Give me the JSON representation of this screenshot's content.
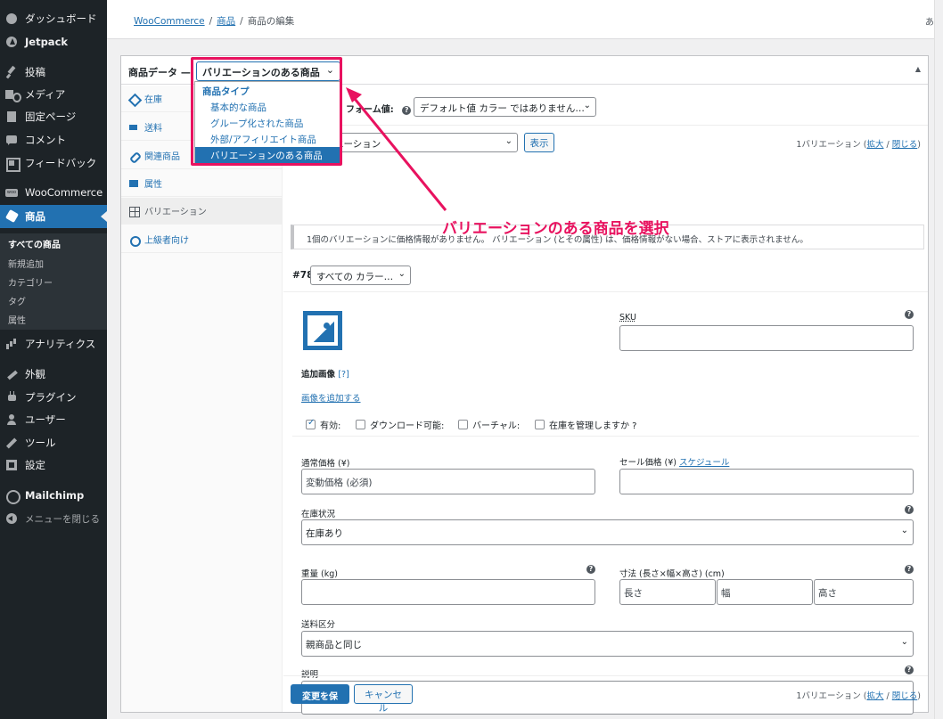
{
  "sidebar": {
    "items": [
      {
        "label": "ダッシュボード",
        "icon": "dashboard-icon"
      },
      {
        "label": "Jetpack",
        "icon": "jetpack-icon"
      },
      {
        "label": "投稿",
        "icon": "pin-icon"
      },
      {
        "label": "メディア",
        "icon": "media-icon"
      },
      {
        "label": "固定ページ",
        "icon": "page-icon"
      },
      {
        "label": "コメント",
        "icon": "comment-icon"
      },
      {
        "label": "フィードバック",
        "icon": "feedback-icon"
      },
      {
        "label": "WooCommerce",
        "icon": "woocommerce-icon"
      },
      {
        "label": "商品",
        "icon": "product-box-icon"
      },
      {
        "label": "アナリティクス",
        "icon": "analytics-icon"
      },
      {
        "label": "外観",
        "icon": "brush-icon"
      },
      {
        "label": "プラグイン",
        "icon": "plugin-icon"
      },
      {
        "label": "ユーザー",
        "icon": "user-icon"
      },
      {
        "label": "ツール",
        "icon": "wrench-icon"
      },
      {
        "label": "設定",
        "icon": "settings-icon"
      },
      {
        "label": "Mailchimp",
        "icon": "mailchimp-icon"
      },
      {
        "label": "メニューを閉じる",
        "icon": "collapse-icon"
      }
    ],
    "submenu": [
      "すべての商品",
      "新規追加",
      "カテゴリー",
      "タグ",
      "属性"
    ]
  },
  "breadcrumb": {
    "woocommerce": "WooCommerce",
    "products": "商品",
    "current": "商品の編集",
    "tail": "あ"
  },
  "panel": {
    "title": "商品データ —",
    "type_selected": "バリエーションのある商品",
    "chevron": "⌄",
    "collapse_arrow": "▲",
    "tabs": [
      {
        "label": "在庫",
        "icon": "inventory-icon"
      },
      {
        "label": "送料",
        "icon": "shipping-icon"
      },
      {
        "label": "関連商品",
        "icon": "link-icon"
      },
      {
        "label": "属性",
        "icon": "attributes-icon"
      },
      {
        "label": "バリエーション",
        "icon": "grid-icon"
      },
      {
        "label": "上級者向け",
        "icon": "gear-icon"
      }
    ]
  },
  "dropdown": {
    "group": "商品タイプ",
    "options": [
      "基本的な商品",
      "グループ化された商品",
      "外部/アフィリエイト商品",
      "バリエーションのある商品"
    ]
  },
  "variations": {
    "default_form_label": "フォーム値:",
    "help": "?",
    "default_value": "デフォルト値 カラー ではありません…",
    "bulk_action": "エーション",
    "show_button": "表示",
    "count_text": "1バリエーション (",
    "expand": "拡大",
    "slash": " / ",
    "close": "閉じる",
    "count_end": ")",
    "notice": "1個のバリエーションに価格情報がありません。 バリエーション (とその属性) は、価格情報がない場合、ストアに表示されません。",
    "variation_id": "#78",
    "variation_attr": "すべての カラー…",
    "sku_label": "SKU",
    "additional_images": "追加画像",
    "additional_images_help": "[?]",
    "add_images": "画像を追加する",
    "checkboxes": [
      {
        "label": "有効:",
        "checked": true
      },
      {
        "label": "ダウンロード可能:",
        "checked": false
      },
      {
        "label": "バーチャル:",
        "checked": false
      },
      {
        "label": "在庫を管理しますか ?",
        "checked": false
      }
    ],
    "regular_price_label": "通常価格 (¥)",
    "regular_price_placeholder": "変動価格 (必須)",
    "sale_price_label": "セール価格 (¥)",
    "schedule": "スケジュール",
    "stock_status_label": "在庫状況",
    "stock_status_value": "在庫あり",
    "weight_label": "重量 (kg)",
    "dimensions_label": "寸法 (長さ×幅×高さ) (cm)",
    "length": "長さ",
    "width": "幅",
    "height": "高さ",
    "shipping_class_label": "送料区分",
    "shipping_class_value": "親商品と同じ",
    "description_label": "説明",
    "save_button": "変更を保存",
    "cancel_button": "キャンセル"
  },
  "annotation": "バリエーションのある商品を選択",
  "colors": {
    "accent": "#2271b1",
    "annotation": "#e8125f",
    "sidebar": "#1d2327"
  }
}
